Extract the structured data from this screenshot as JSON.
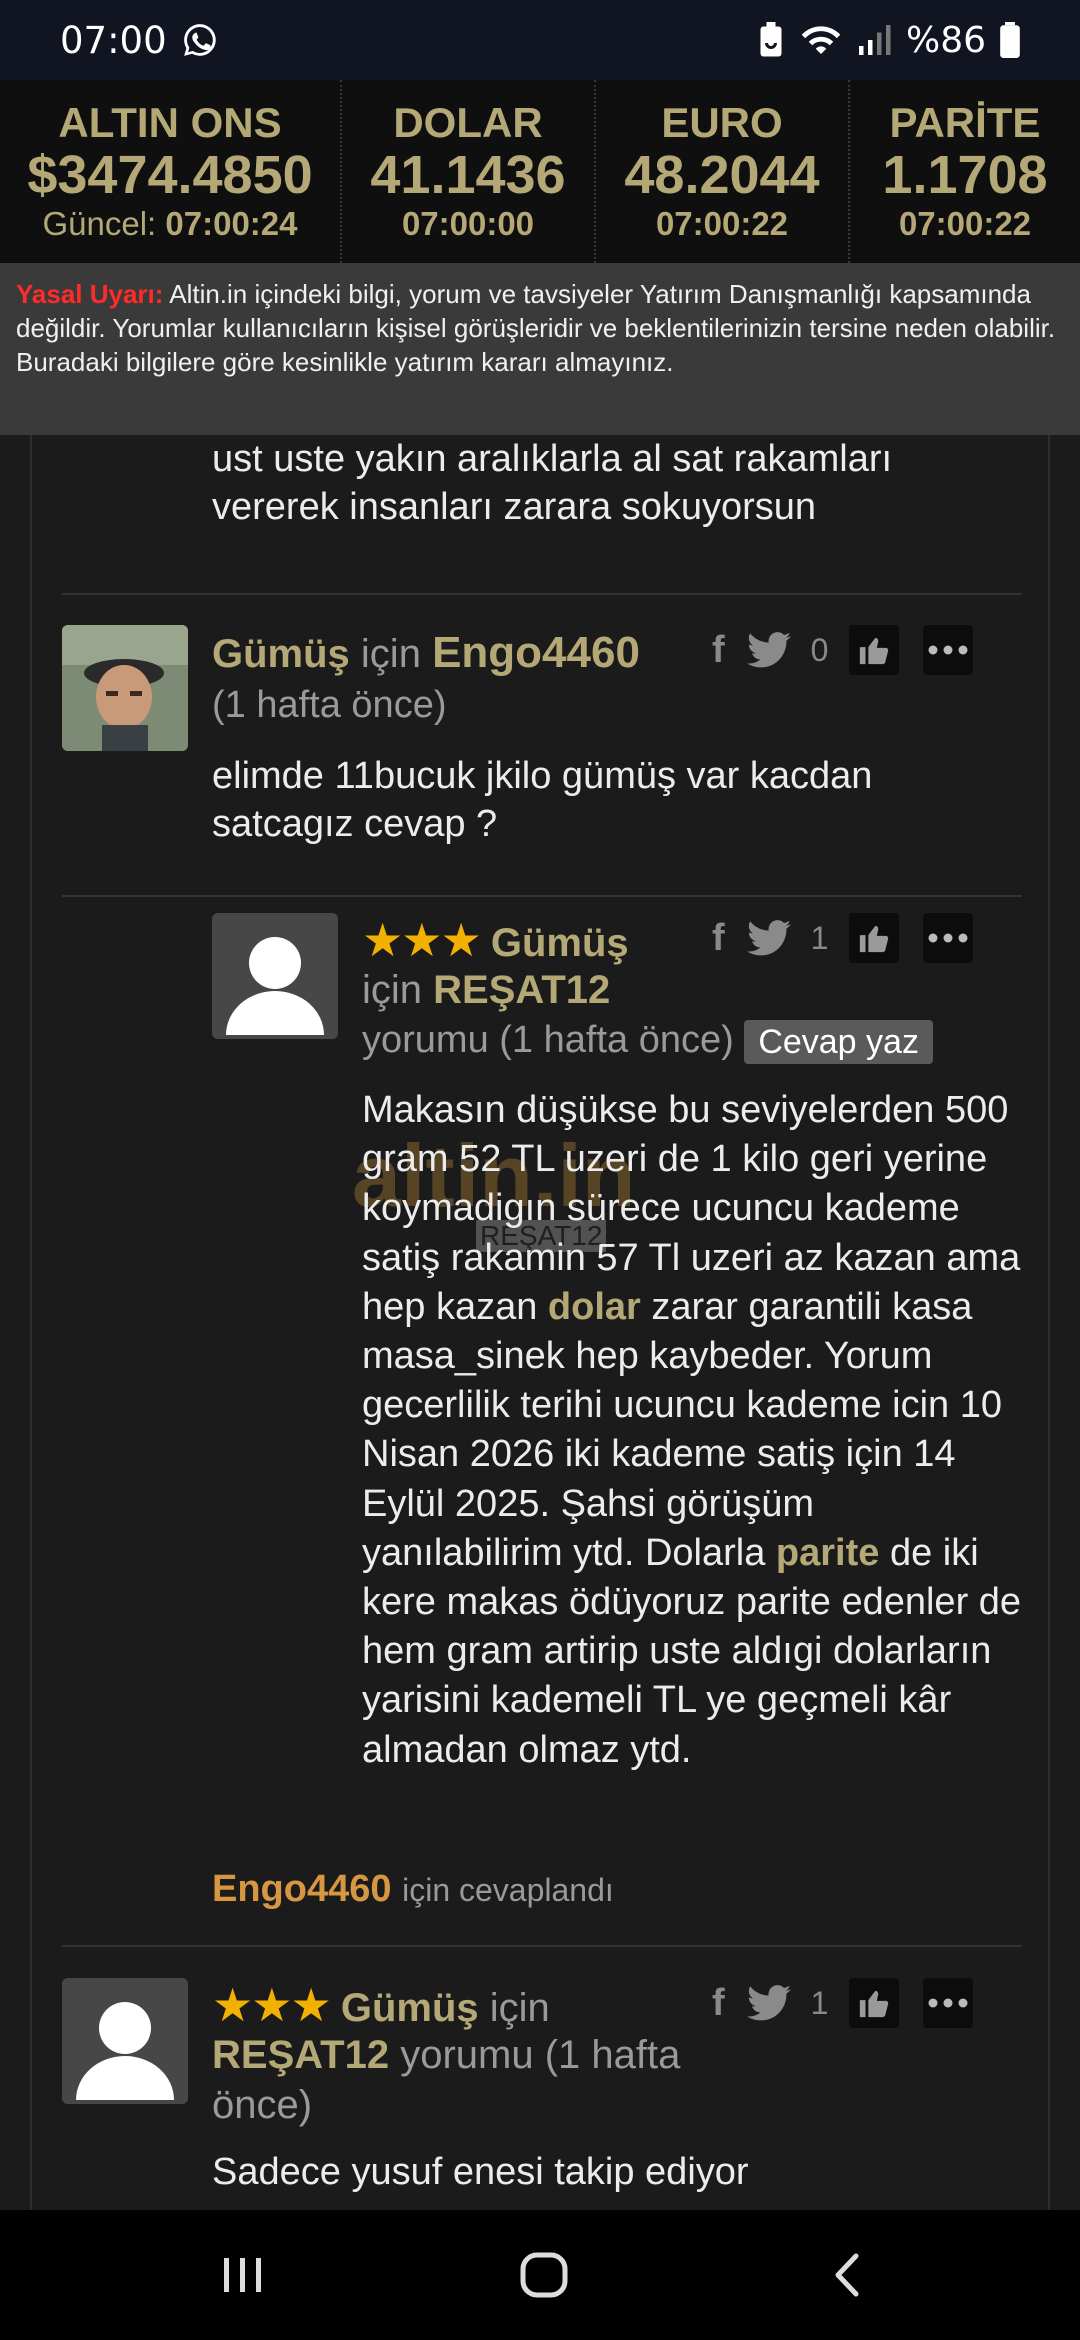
{
  "status_bar": {
    "time": "07:00",
    "battery": "%86",
    "icons": [
      "whatsapp-icon",
      "battery-saver-icon",
      "wifi-icon",
      "signal-icon",
      "battery-icon"
    ]
  },
  "ticker": [
    {
      "name": "ALTIN ONS",
      "price": "$3474.4850",
      "time_prefix": "Güncel:",
      "time": "07:00:24"
    },
    {
      "name": "DOLAR",
      "price": "41.1436",
      "time": "07:00:00"
    },
    {
      "name": "EURO",
      "price": "48.2044",
      "time": "07:00:22"
    },
    {
      "name": "PARİTE",
      "price": "1.1708",
      "time": "07:00:22"
    }
  ],
  "warning": {
    "label": "Yasal Uyarı:",
    "text": " Altin.in içindeki bilgi, yorum ve tavsiyeler Yatırım Danışmanlığı kapsamında değildir. Yorumlar kullanıcıların kişisel görüşleridir ve beklentilerinizin tersine neden olabilir. Buradaki bilgilere göre kesinlikle yatırım kararı almayınız."
  },
  "comments": {
    "prev_tail": "ust uste yakın aralıklarla al sat rakamları vererek insanları zarara sokuyorsun",
    "c1": {
      "topic": "Gümüş",
      "for": "için",
      "user": "Engo4460",
      "time": "(1 hafta önce)",
      "count": "0",
      "body": "elimde 11bucuk jkilo gümüş var kacdan satcagız cevap ?"
    },
    "c2": {
      "stars": "★★★",
      "topic": "Gümüş",
      "for": "için",
      "user": "REŞAT12",
      "yorumu": "yorumu (1 hafta önce)",
      "reply_btn": "Cevap yaz",
      "count": "1",
      "body_1": "Makasın düşükse bu seviyelerden 500 gram 52 TL uzeri de 1 kilo geri yerine koymadigın sürece ucuncu kademe satiş rakamin 57 Tl uzeri az kazan ama hep kazan ",
      "link_dolar": "dolar",
      "body_2": " zarar garantili kasa masa_sinek hep kaybeder. Yorum gecerlilik terihi ucuncu kademe icin 10 Nisan 2026 iki kademe satiş için 14 Eylül 2025. Şahsi görüşüm yanılabilirim ytd. Dolarla ",
      "link_parite": "parite",
      "body_3": " de iki kere makas ödüyoruz parite edenler de hem gram artirip uste aldıgi dolarların yarisini kademeli TL ye geçmeli kâr almadan olmaz ytd.",
      "watermark": "altin.in",
      "watermark_user": "REŞAT12",
      "replied_user": "Engo4460",
      "replied_text": "için cevaplandı"
    },
    "c3": {
      "stars": "★★★",
      "topic": "Gümüş",
      "for": "için",
      "user": "REŞAT12",
      "yorumu": "yorumu (1 hafta önce)",
      "count": "1",
      "body": "Sadece yusuf enesi takip ediyor"
    }
  },
  "colors": {
    "gold": "#b3a876",
    "orange": "#d69642",
    "warning_red": "#ff2a2a",
    "star": "#f2b100"
  }
}
